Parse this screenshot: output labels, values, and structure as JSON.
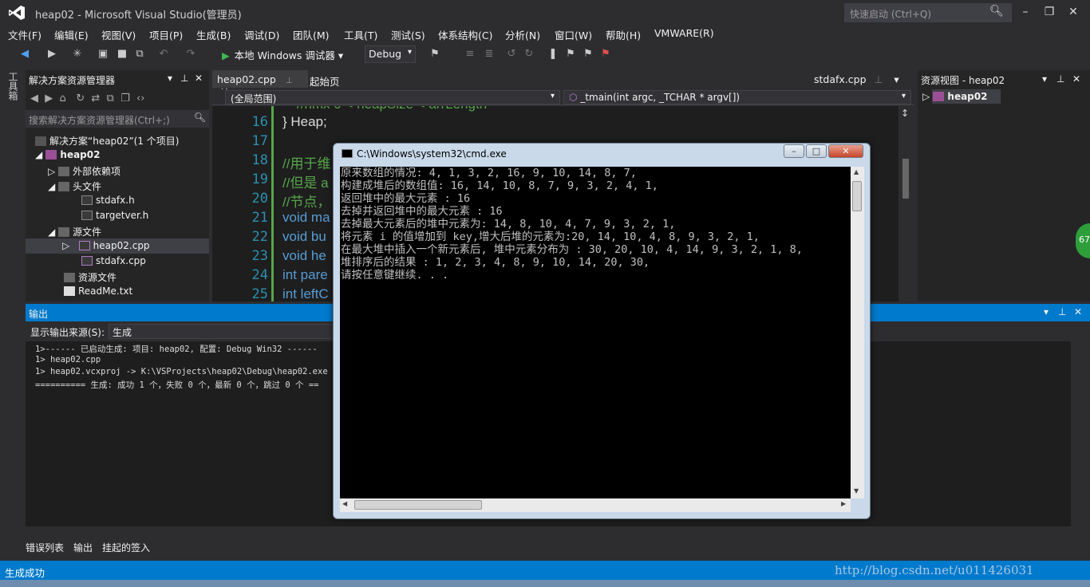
{
  "window": {
    "title": "heap02 - Microsoft Visual Studio(管理员)",
    "quick_launch": "快速启动 (Ctrl+Q)"
  },
  "menu": [
    "文件(F)",
    "编辑(E)",
    "视图(V)",
    "项目(P)",
    "生成(B)",
    "调试(D)",
    "团队(M)",
    "工具(T)",
    "测试(S)",
    "体系结构(C)",
    "分析(N)",
    "窗口(W)",
    "帮助(H)",
    "VMWARE(R)"
  ],
  "toolbar": {
    "run_label": "本地 Windows 调试器",
    "config": "Debug"
  },
  "left_dock": {
    "toolbox": "工具箱"
  },
  "solution_explorer": {
    "title": "解决方案资源管理器",
    "search_placeholder": "搜索解决方案资源管理器(Ctrl+;)",
    "items": [
      {
        "label": "解决方案“heap02”(1 个项目)"
      },
      {
        "label": "heap02"
      },
      {
        "label": "外部依赖项"
      },
      {
        "label": "头文件"
      },
      {
        "label": "stdafx.h"
      },
      {
        "label": "targetver.h"
      },
      {
        "label": "源文件"
      },
      {
        "label": "heap02.cpp"
      },
      {
        "label": "stdafx.cpp"
      },
      {
        "label": "资源文件"
      },
      {
        "label": "ReadMe.txt"
      }
    ]
  },
  "editor": {
    "tabs": [
      "heap02.cpp",
      "起始页",
      "stdafx.cpp"
    ],
    "scope": "(全局范围)",
    "function": "_tmain(int argc, _TCHAR * argv[])",
    "lines": [
      {
        "n": "16",
        "code": "} Heap;"
      },
      {
        "n": "17",
        "code": ""
      },
      {
        "n": "18",
        "code": "//用于维"
      },
      {
        "n": "19",
        "code": "//但是 a"
      },
      {
        "n": "20",
        "code": "//节点，"
      },
      {
        "n": "21",
        "code": "void ma"
      },
      {
        "n": "22",
        "code": "void bu"
      },
      {
        "n": "23",
        "code": "void he"
      },
      {
        "n": "24",
        "code": "int pare"
      },
      {
        "n": "25",
        "code": "int leftC"
      }
    ],
    "partial_top": "//hmx 0 < heapSize < arrLength"
  },
  "resource_view": {
    "title": "资源视图 - heap02",
    "root": "heap02"
  },
  "output": {
    "title": "输出",
    "source_label": "显示输出来源(S):",
    "source_value": "生成",
    "lines": [
      "1>------ 已启动生成: 项目: heap02, 配置: Debug Win32 ------",
      "1>  heap02.cpp",
      "1>  heap02.vcxproj -> K:\\VSProjects\\heap02\\Debug\\heap02.exe",
      "========== 生成: 成功 1 个，失败 0 个，最新 0 个，跳过 0 个 =="
    ]
  },
  "bottom_tabs": [
    "错误列表",
    "输出",
    "挂起的签入"
  ],
  "status": "生成成功",
  "watermark": "http://blog.csdn.net/u011426031",
  "cmd": {
    "title": "C:\\Windows\\system32\\cmd.exe",
    "lines": [
      "原来数组的情况: 4, 1, 3, 2, 16, 9, 10, 14, 8, 7,",
      "构建成堆后的数组值: 16, 14, 10, 8, 7, 9, 3, 2, 4, 1,",
      "返回堆中的最大元素 : 16",
      "去掉并返回堆中的最大元素 : 16",
      "去掉最大元素后的堆中元素为: 14, 8, 10, 4, 7, 9, 3, 2, 1,",
      "将元素 i 的值增加到 key,增大后堆的元素为:20, 14, 10, 4, 8, 9, 3, 2, 1,",
      "在最大堆中插入一个新元素后, 堆中元素分布为 : 30, 20, 10, 4, 14, 9, 3, 2, 1, 8,",
      "堆排序后的结果 : 1, 2, 3, 4, 8, 9, 10, 14, 20, 30,",
      "请按任意键继续. . ."
    ]
  },
  "badge": "67"
}
